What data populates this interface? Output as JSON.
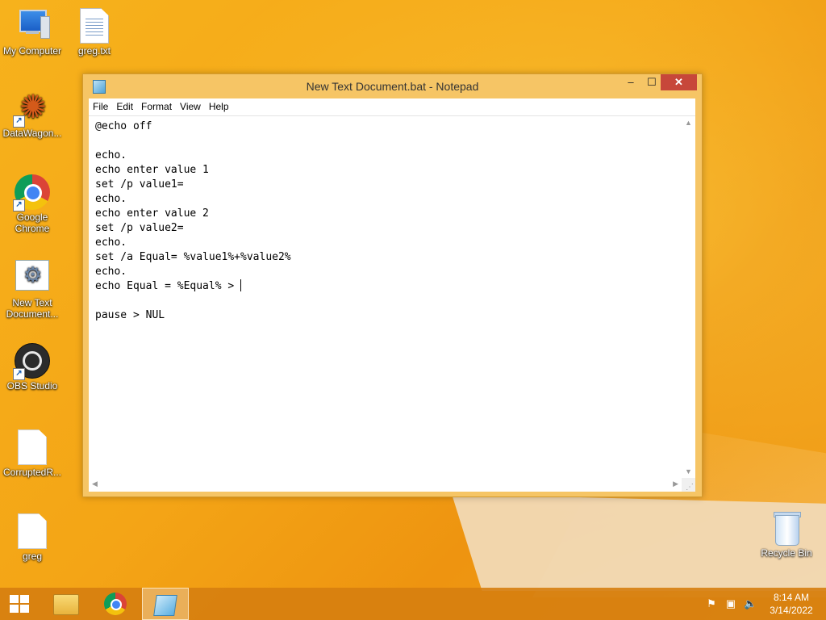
{
  "desktop": {
    "icons": [
      {
        "label": "My Computer"
      },
      {
        "label": "greg.txt"
      },
      {
        "label": "DataWagon..."
      },
      {
        "label": "Google Chrome"
      },
      {
        "label": "New Text Document..."
      },
      {
        "label": "OBS Studio"
      },
      {
        "label": "CorruptedR..."
      },
      {
        "label": "greg"
      },
      {
        "label": "Recycle Bin"
      }
    ]
  },
  "window": {
    "title": "New Text Document.bat - Notepad",
    "controls": {
      "minimize": "–",
      "maximize": "☐",
      "close": "✕"
    },
    "menu": [
      "File",
      "Edit",
      "Format",
      "View",
      "Help"
    ],
    "editor_lines": [
      "@echo off",
      "",
      "echo.",
      "echo enter value 1",
      "set /p value1=",
      "echo.",
      "echo enter value 2",
      "set /p value2=",
      "echo.",
      "set /a Equal= %value1%+%value2%",
      "echo.",
      "echo Equal = %Equal% > ",
      "",
      "pause > NUL"
    ],
    "cursor_line": 11
  },
  "taskbar": {
    "items": [
      "start-icon",
      "file-explorer-icon",
      "chrome-icon",
      "notepad-icon"
    ],
    "tray_icons": [
      "action-center-flag-icon",
      "network-icon",
      "volume-muted-icon"
    ],
    "clock": {
      "time": "8:14 AM",
      "date": "3/14/2022"
    }
  },
  "colors": {
    "accent": "#f4a516",
    "close": "#c7473a",
    "window_frame": "#f6c565"
  }
}
